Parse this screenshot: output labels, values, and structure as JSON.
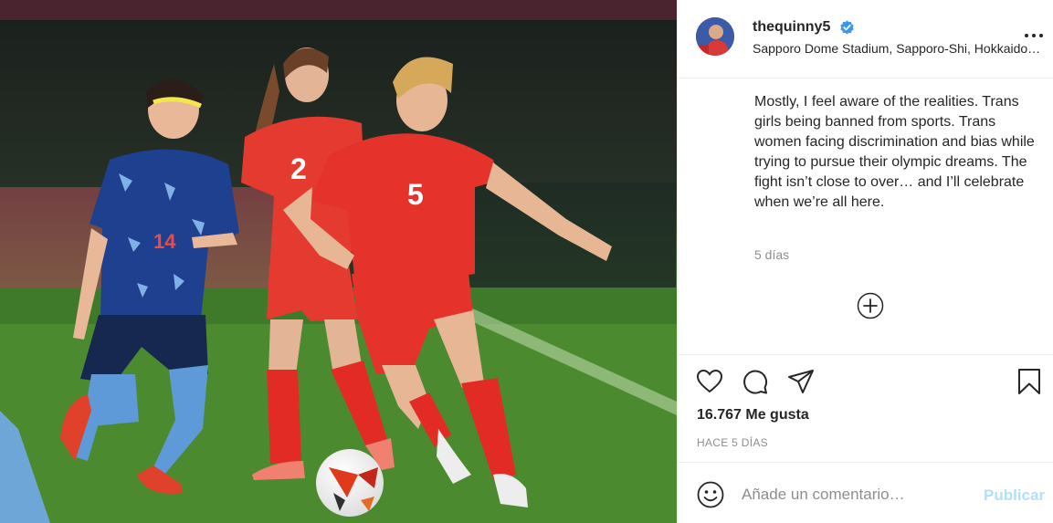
{
  "post": {
    "photo_alt": "Soccer players on the pitch",
    "player_numbers": [
      "14",
      "2",
      "5"
    ],
    "ball_logo": ""
  },
  "header": {
    "username": "thequinny5",
    "location": "Sapporo Dome Stadium, Sapporo-Shi, Hokkaido, Japan",
    "more_icon": "more-options-icon",
    "verified_icon": "verified-badge-icon"
  },
  "caption": {
    "text": "Mostly, I feel aware of the realities. Trans girls being banned from sports. Trans women facing discrimination and bias while trying to pursue their olympic dreams. The fight isn’t close to over… and I’ll celebrate when we’re all here.",
    "time": "5 días"
  },
  "load_more_icon": "plus-circle-icon",
  "actions": {
    "like_icon": "heart-icon",
    "comment_icon": "comment-icon",
    "share_icon": "send-icon",
    "save_icon": "bookmark-icon"
  },
  "likes": "16.767 Me gusta",
  "posted_ago": "HACE 5 DÍAS",
  "comment": {
    "placeholder": "Añade un comentario…",
    "value": "",
    "publish_label": "Publicar",
    "emoji_icon": "smiley-icon"
  },
  "colors": {
    "accent_disabled": "#b2dffc",
    "verified": "#3897f0",
    "secondary_text": "#8e8e8e",
    "canada_red": "#e02a2a",
    "japan_blue": "#1f3f8f"
  }
}
